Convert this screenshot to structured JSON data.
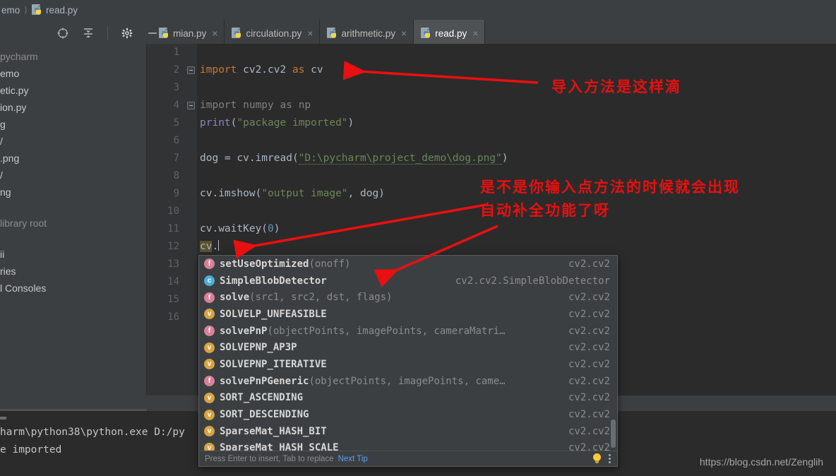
{
  "breadcrumb": {
    "project": "emo",
    "file": "read.py",
    "separator": "⟩"
  },
  "toolbar": {
    "locate_icon": "crosshair-target-icon",
    "collapse_icon": "collapse-all-icon",
    "settings_icon": "gear-icon",
    "hide_icon": "minimize-icon"
  },
  "tabs": [
    {
      "label": "mian.py",
      "close": "×",
      "active": false
    },
    {
      "label": "circulation.py",
      "close": "×",
      "active": false
    },
    {
      "label": "arithmetic.py",
      "close": "×",
      "active": false
    },
    {
      "label": "read.py",
      "close": "×",
      "active": true
    }
  ],
  "sidebar": {
    "items": [
      {
        "label": "pycharm",
        "muted": true
      },
      {
        "label": "emo",
        "muted": false
      },
      {
        "label": "etic.py",
        "muted": false
      },
      {
        "label": "ion.py",
        "muted": false
      },
      {
        "label": "g",
        "muted": false
      },
      {
        "label": "/",
        "muted": false
      },
      {
        "label": ".png",
        "muted": false
      },
      {
        "label": "/",
        "muted": false
      },
      {
        "label": "ng",
        "muted": false
      },
      {
        "label": "library root",
        "muted": true
      },
      {
        "label": "ii",
        "muted": false
      },
      {
        "label": "ries",
        "muted": false
      },
      {
        "label": "l Consoles",
        "muted": false
      }
    ]
  },
  "editor": {
    "line_numbers": [
      "1",
      "2",
      "3",
      "4",
      "5",
      "6",
      "7",
      "8",
      "9",
      "10",
      "11",
      "12",
      "13",
      "14",
      "15",
      "16"
    ],
    "code": {
      "l2_import": "import",
      "l2_module": " cv2.cv2 ",
      "l2_as": "as",
      "l2_alias": " cv",
      "l4_import": "import",
      "l4_rest": " numpy as np",
      "l5_fn": "print",
      "l5_open": "(",
      "l5_str": "\"package imported\"",
      "l5_close": ")",
      "l7_lhs": "dog = cv.imread(",
      "l7_path": "\"D:\\pycharm\\project_demo\\dog.png\"",
      "l7_close": ")",
      "l9_lhs": "cv.imshow(",
      "l9_str": "\"output image\"",
      "l9_mid": ", dog)",
      "l11_lhs": "cv.waitKey(",
      "l11_num": "0",
      "l11_close": ")",
      "l12_hl": "cv",
      "l12_dot": "."
    }
  },
  "autocomplete": {
    "items": [
      {
        "kind": "f",
        "name": "setUseOptimized",
        "args": "(onoff)",
        "module": "cv2.cv2"
      },
      {
        "kind": "c",
        "name": "SimpleBlobDetector",
        "args": "",
        "module": "cv2.cv2.SimpleBlobDetector"
      },
      {
        "kind": "f",
        "name": "solve",
        "args": "(src1, src2, dst, flags)",
        "module": "cv2.cv2"
      },
      {
        "kind": "v",
        "name": "SOLVELP_UNFEASIBLE",
        "args": "",
        "module": "cv2.cv2"
      },
      {
        "kind": "f",
        "name": "solvePnP",
        "args": "(objectPoints, imagePoints, cameraMatri…",
        "module": "cv2.cv2"
      },
      {
        "kind": "v",
        "name": "SOLVEPNP_AP3P",
        "args": "",
        "module": "cv2.cv2"
      },
      {
        "kind": "v",
        "name": "SOLVEPNP_ITERATIVE",
        "args": "",
        "module": "cv2.cv2"
      },
      {
        "kind": "f",
        "name": "solvePnPGeneric",
        "args": "(objectPoints, imagePoints, came…",
        "module": "cv2.cv2"
      },
      {
        "kind": "v",
        "name": "SORT_ASCENDING",
        "args": "",
        "module": "cv2.cv2"
      },
      {
        "kind": "v",
        "name": "SORT_DESCENDING",
        "args": "",
        "module": "cv2.cv2"
      },
      {
        "kind": "v",
        "name": "SparseMat_HASH_BIT",
        "args": "",
        "module": "cv2.cv2"
      },
      {
        "kind": "v",
        "name": "SparseMat_HASH_SCALE",
        "args": "",
        "module": "cv2.cv2"
      }
    ],
    "footer_hint": "Press Enter to insert, Tab to replace",
    "footer_link": "Next Tip",
    "bulb_icon": "lightbulb-icon",
    "menu_icon": "kebab-menu-icon"
  },
  "console": {
    "lines": [
      "harm\\python38\\python.exe D:/py",
      "e imported"
    ]
  },
  "annotations": [
    {
      "text": "导入方法是这样滴"
    },
    {
      "text": "是不是你输入点方法的时候就会出现"
    },
    {
      "text": "自动补全功能了呀"
    }
  ],
  "watermark": {
    "text": "https://blog.csdn.net/Zenglih"
  },
  "colors": {
    "accent_tab": "#4a88c7",
    "annotation_red": "#e81010",
    "editor_bg": "#2b2b2b",
    "panel_bg": "#3c3f41",
    "keyword": "#cc7832",
    "string": "#6a8759",
    "function": "#ffc66d",
    "builtin": "#8888c6"
  }
}
